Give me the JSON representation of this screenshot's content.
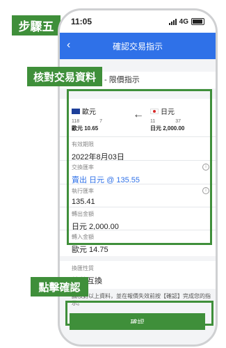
{
  "step_badge": "步驟五",
  "status_bar": {
    "time": "11:05",
    "network": "4G"
  },
  "nav": {
    "title": "確認交易指示"
  },
  "order_type": "- 限價指示",
  "callouts": {
    "verify": "核對交易資料",
    "click_confirm": "點擊確認"
  },
  "from_currency": {
    "name": "歐元",
    "n1": "118",
    "n2": "7",
    "amount": "歐元 10.65"
  },
  "to_currency": {
    "name": "日元",
    "n1": "11",
    "n2": "37",
    "amount": "日元 2,000.00"
  },
  "fields": {
    "expiry_label": "有效期限",
    "expiry_value": "2022年8月03日",
    "rate_label": "交換匯率",
    "rate_value": "賣出 日元 @ 135.55",
    "exec_label": "執行匯率",
    "exec_value": "135.41",
    "out_label": "轉出金額",
    "out_value": "日元 2,000.00",
    "in_label": "轉入金額",
    "in_value": "歐元 14.75",
    "nature_label": "換匯性質",
    "nature_value": "外幣互換"
  },
  "note": "請核對以上資料，並在報價失效前按【確認】完成您的指示。",
  "confirm_button": "確認",
  "colors": {
    "accent_green": "#3f8f3a",
    "nav_blue": "#2f71e8"
  }
}
